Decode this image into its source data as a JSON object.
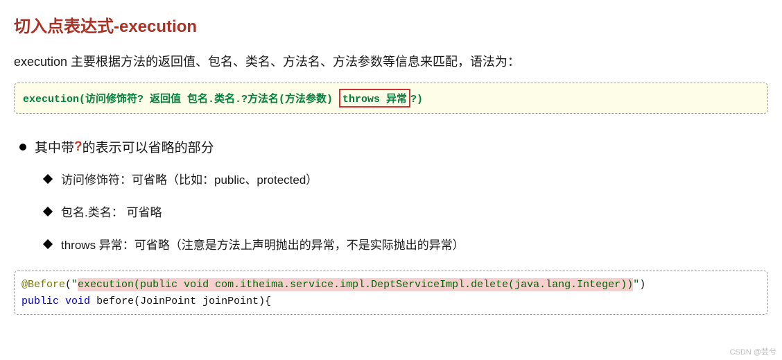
{
  "heading": "切入点表达式-execution",
  "intro": "execution 主要根据方法的返回值、包名、类名、方法名、方法参数等信息来匹配，语法为：",
  "syntax": {
    "prefix": "execution(访问修饰符?  返回值  包名.类名.?方法名(方法参数) ",
    "throws": "throws 异常",
    "suffix": "?)"
  },
  "bullet_main": {
    "before": "其中带 ",
    "qmark": "?",
    "after": " 的表示可以省略的部分"
  },
  "sub_items": [
    "访问修饰符：可省略（比如：public、protected）",
    "包名.类名： 可省略",
    "throws 异常：可省略（注意是方法上声明抛出的异常，不是实际抛出的异常）"
  ],
  "code": {
    "annotation": "@Before",
    "paren_open": "(",
    "string_open": "\"",
    "execution_expr": "execution(public void com.itheima.service.impl.DeptServiceImpl.delete(java.lang.Integer))",
    "string_close": "\"",
    "paren_close": ")",
    "line2_kw1": "public",
    "line2_kw2": "void",
    "line2_method": "before",
    "line2_params": "(JoinPoint joinPoint){"
  },
  "watermark": "CSDN @芸兮"
}
